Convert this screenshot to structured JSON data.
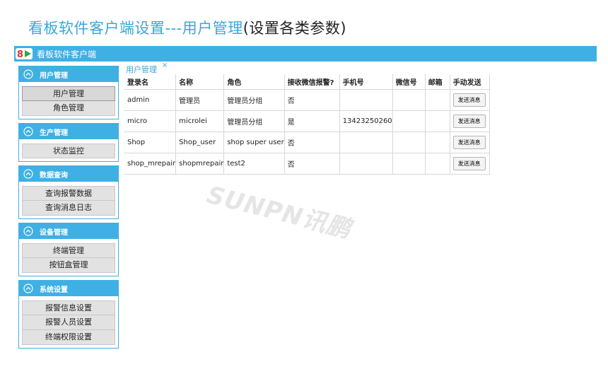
{
  "heading": {
    "main": "看板软件客户端设置---用户管理",
    "paren": "(设置各类参数)"
  },
  "app": {
    "title": "看板软件客户端",
    "logo_icon": "sunpn-logo-icon"
  },
  "sidebar": {
    "groups": [
      {
        "title": "用户管理",
        "items": [
          "用户管理",
          "角色管理"
        ],
        "selected": 0
      },
      {
        "title": "生产管理",
        "items": [
          "状态监控"
        ]
      },
      {
        "title": "数据查询",
        "items": [
          "查询报警数据",
          "查询消息日志"
        ]
      },
      {
        "title": "设备管理",
        "items": [
          "终端管理",
          "按钮盒管理"
        ]
      },
      {
        "title": "系统设置",
        "items": [
          "报警信息设置",
          "报警人员设置",
          "终端权限设置"
        ]
      }
    ]
  },
  "tab": {
    "label": "用户管理",
    "close": "×"
  },
  "table": {
    "columns": [
      "登录名",
      "名称",
      "角色",
      "接收微信报警?",
      "手机号",
      "微信号",
      "邮箱",
      "手动发送"
    ],
    "rows": [
      [
        "admin",
        "管理员",
        "管理员分组",
        "否",
        "",
        "",
        "",
        "发送消息"
      ],
      [
        "micro",
        "microlei",
        "管理员分组",
        "是",
        "13423250260",
        "",
        "",
        "发送消息"
      ],
      [
        "Shop",
        "Shop_user",
        "shop super user",
        "否",
        "",
        "",
        "",
        "发送消息"
      ],
      [
        "shop_mrepair",
        "shopmrepair",
        "test2",
        "否",
        "",
        "",
        "",
        "发送消息"
      ]
    ]
  },
  "watermark": "SUNPN讯鹏",
  "colors": {
    "accent": "#3fb0e3",
    "heading_blue": "#3aa7d9"
  }
}
